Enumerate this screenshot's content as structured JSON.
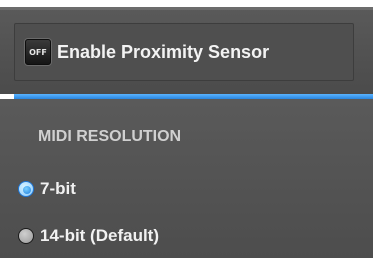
{
  "proximity_sensor": {
    "toggle_state_text": "OFF",
    "label": "Enable Proximity Sensor"
  },
  "midi_resolution": {
    "heading": "MIDI RESOLUTION",
    "options": [
      {
        "label": "7-bit",
        "selected": true
      },
      {
        "label": "14-bit (Default)",
        "selected": false
      }
    ]
  },
  "colors": {
    "panel_background": "#555555",
    "accent_blue": "#2a86e0",
    "text_primary": "#f1f1f1",
    "heading_text": "#d0d0d0"
  },
  "icons": {
    "toggle": "off-toggle-icon",
    "radio_selected": "radio-selected-icon",
    "radio_unselected": "radio-unselected-icon"
  }
}
